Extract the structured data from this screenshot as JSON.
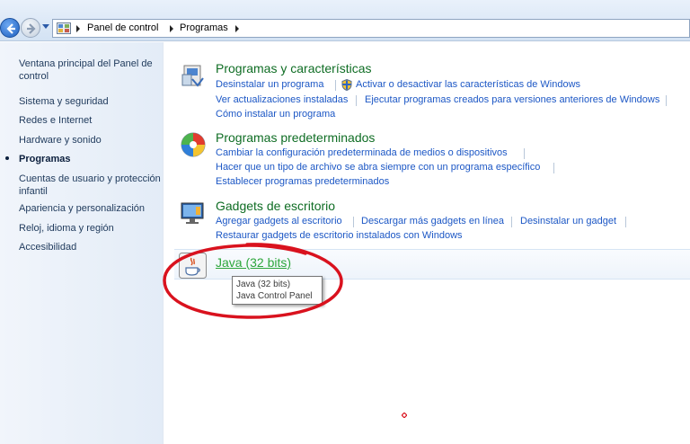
{
  "breadcrumb": [
    "Panel de control",
    "Programas"
  ],
  "sidebar": {
    "items": [
      {
        "label": "Ventana principal del Panel de control",
        "active": false
      },
      {
        "label": "Sistema y seguridad",
        "active": false
      },
      {
        "label": "Redes e Internet",
        "active": false
      },
      {
        "label": "Hardware y sonido",
        "active": false
      },
      {
        "label": "Programas",
        "active": true
      },
      {
        "label": "Cuentas de usuario y protección infantil",
        "active": false
      },
      {
        "label": "Apariencia y personalización",
        "active": false
      },
      {
        "label": "Reloj, idioma y región",
        "active": false
      },
      {
        "label": "Accesibilidad",
        "active": false
      }
    ]
  },
  "sections": [
    {
      "title": "Programas y características",
      "icon": "programs-features-icon",
      "links": [
        "Desinstalar un programa",
        "Activar o desactivar las características de Windows",
        "Ver actualizaciones instaladas",
        "Ejecutar programas creados para versiones anteriores de Windows",
        "Cómo instalar un programa"
      ]
    },
    {
      "title": "Programas predeterminados",
      "icon": "default-programs-icon",
      "links": [
        "Cambiar la configuración predeterminada de medios o dispositivos",
        "Hacer que un tipo de archivo se abra siempre con un programa específico",
        "Establecer programas predeterminados"
      ]
    },
    {
      "title": "Gadgets de escritorio",
      "icon": "desktop-gadgets-icon",
      "links": [
        "Agregar gadgets al escritorio",
        "Descargar más gadgets en línea",
        "Desinstalar un gadget",
        "Restaurar gadgets de escritorio instalados con Windows"
      ]
    }
  ],
  "java": {
    "title": "Java (32 bits)",
    "icon": "java-icon",
    "tooltip_line1": "Java (32 bits)",
    "tooltip_line2": "Java Control Panel"
  },
  "colors": {
    "section_title": "#0f6d24",
    "link": "#1c57c5",
    "annotation_circle": "#d9121e"
  }
}
